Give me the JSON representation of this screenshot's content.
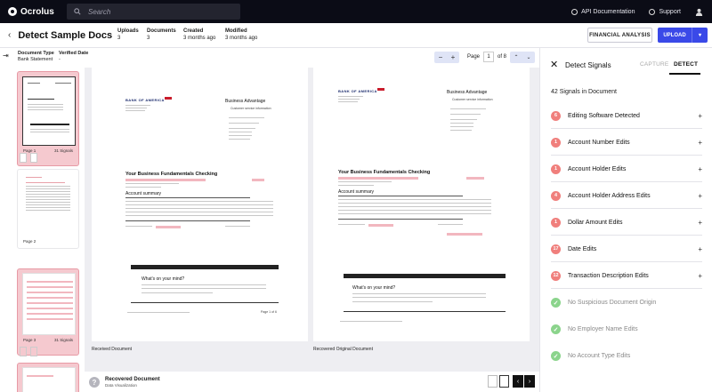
{
  "app": {
    "logo_text": "Ocrolus",
    "search_placeholder": "Search"
  },
  "nav": {
    "api_docs": "API Documentation",
    "support": "Support"
  },
  "header": {
    "title": "Detect Sample Docs",
    "uploads_label": "Uploads",
    "uploads_value": "3",
    "documents_label": "Documents",
    "documents_value": "3",
    "created_label": "Created",
    "created_value": "3 months ago",
    "modified_label": "Modified",
    "modified_value": "3 months ago",
    "financial_analysis": "FINANCIAL ANALYSIS",
    "upload": "UPLOAD"
  },
  "toolbar": {
    "doc_type_label": "Document Type",
    "doc_type_value": "Bank Statement",
    "verified_date_label": "Verified Date",
    "verified_date_value": "-",
    "page_label": "Page",
    "page_value": "1",
    "page_of": "of 8"
  },
  "thumbnails": [
    {
      "page": "Page 1",
      "signals": "31 Signals"
    },
    {
      "page": "Page 2",
      "signals": ""
    },
    {
      "page": "Page 3",
      "signals": "31 Signals"
    }
  ],
  "viewer": {
    "left_caption": "Received Document",
    "right_caption": "Recovered Original Document",
    "bank_name": "BANK OF AMERICA",
    "business_advantage": "Business Advantage",
    "customer_service": "Customer service information",
    "checking_title": "Your Business Fundamentals Checking",
    "account_summary": "Account summary",
    "whats_on_mind": "What's on your mind?",
    "page_footer": "Page 1 of 6"
  },
  "bottom": {
    "title": "Recovered Document",
    "subtitle": "Data Visualization"
  },
  "panel": {
    "title": "Detect Signals",
    "tab_capture": "CAPTURE",
    "tab_detect": "DETECT",
    "count": "42 Signals in Document",
    "signals": [
      {
        "count": "6",
        "label": "Editing Software Detected",
        "status": "red"
      },
      {
        "count": "1",
        "label": "Account Number Edits",
        "status": "red"
      },
      {
        "count": "1",
        "label": "Account Holder Edits",
        "status": "red"
      },
      {
        "count": "4",
        "label": "Account Holder Address Edits",
        "status": "red"
      },
      {
        "count": "1",
        "label": "Dollar Amount Edits",
        "status": "red"
      },
      {
        "count": "17",
        "label": "Date Edits",
        "status": "red"
      },
      {
        "count": "12",
        "label": "Transaction Description Edits",
        "status": "red"
      },
      {
        "count": "✓",
        "label": "No Suspicious Document Origin",
        "status": "green"
      },
      {
        "count": "✓",
        "label": "No Employer Name Edits",
        "status": "green"
      },
      {
        "count": "✓",
        "label": "No Account Type Edits",
        "status": "green"
      }
    ]
  },
  "colors": {
    "accent": "#3a49e8",
    "signal_red": "#f07f7c",
    "signal_green": "#8bd48c",
    "thumb_selected": "#f5c9cf"
  }
}
